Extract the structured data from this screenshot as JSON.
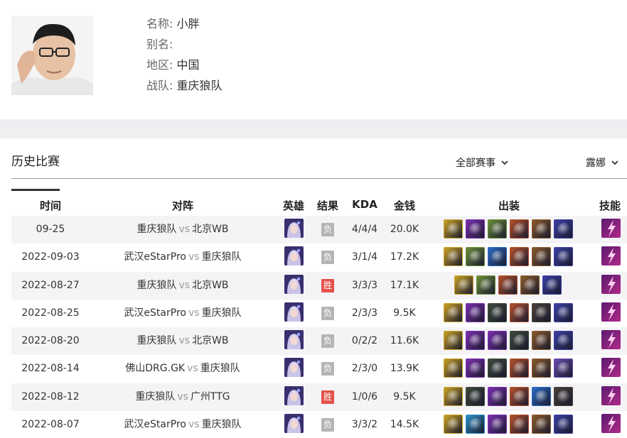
{
  "player": {
    "name_label": "名称:",
    "name": "小胖",
    "alias_label": "别名:",
    "alias": "",
    "region_label": "地区:",
    "region": "中国",
    "team_label": "战队:",
    "team": "重庆狼队"
  },
  "section": {
    "title": "历史比赛",
    "event_filter": "全部赛事",
    "hero_filter": "露娜"
  },
  "table": {
    "headers": {
      "time": "时间",
      "match": "对阵",
      "hero": "英雄",
      "result": "结果",
      "kda": "KDA",
      "gold": "金钱",
      "items": "出装",
      "skill": "技能"
    },
    "vs": "vs",
    "rows": [
      {
        "date": "09-25",
        "home": "重庆狼队",
        "away": "北京WB",
        "result": "负",
        "win": false,
        "kda": "4/4/4",
        "gold": "20.0K",
        "items": [
          "#c9a227",
          "#7a2fb0",
          "#6b8f3a",
          "#b2502c",
          "#8a5a2b",
          "#3b3fa3"
        ]
      },
      {
        "date": "2022-09-03",
        "home": "武汉eStarPro",
        "away": "重庆狼队",
        "result": "负",
        "win": false,
        "kda": "3/1/4",
        "gold": "17.2K",
        "items": [
          "#c9a227",
          "#6b8f3a",
          "#2a6bc4",
          "#b2502c",
          "#8a5a2b",
          "#3b3fa3"
        ]
      },
      {
        "date": "2022-08-27",
        "home": "重庆狼队",
        "away": "北京WB",
        "result": "胜",
        "win": true,
        "kda": "3/3/3",
        "gold": "17.1K",
        "items": [
          "#c9a227",
          "#6b8f3a",
          "#b2502c",
          "#8a5a2b",
          "#3b3fa3"
        ]
      },
      {
        "date": "2022-08-25",
        "home": "武汉eStarPro",
        "away": "重庆狼队",
        "result": "负",
        "win": false,
        "kda": "2/3/3",
        "gold": "9.5K",
        "items": [
          "#c9a227",
          "#7a2fb0",
          "#3d4a3a",
          "#b2502c",
          "#4a4038",
          "#3b3fa3"
        ]
      },
      {
        "date": "2022-08-20",
        "home": "重庆狼队",
        "away": "北京WB",
        "result": "负",
        "win": false,
        "kda": "0/2/2",
        "gold": "11.6K",
        "items": [
          "#c9a227",
          "#7a2fb0",
          "#7a2fb0",
          "#3d4a3a",
          "#8a5a2b",
          "#3b3fa3"
        ]
      },
      {
        "date": "2022-08-14",
        "home": "佛山DRG.GK",
        "away": "重庆狼队",
        "result": "负",
        "win": false,
        "kda": "2/3/0",
        "gold": "13.9K",
        "items": [
          "#c9a227",
          "#7a2fb0",
          "#3d4a3a",
          "#b2502c",
          "#8a5a2b",
          "#6a4bb0"
        ]
      },
      {
        "date": "2022-08-12",
        "home": "重庆狼队",
        "away": "广州TTG",
        "result": "胜",
        "win": true,
        "kda": "1/0/6",
        "gold": "9.5K",
        "items": [
          "#c9a227",
          "#3d4a3a",
          "#7a2fb0",
          "#b2502c",
          "#2a6bc4",
          "#4a4038"
        ]
      },
      {
        "date": "2022-08-07",
        "home": "武汉eStarPro",
        "away": "重庆狼队",
        "result": "负",
        "win": false,
        "kda": "3/3/2",
        "gold": "14.5K",
        "items": [
          "#c9a227",
          "#2a8fc4",
          "#7a2fb0",
          "#b2502c",
          "#8a5a2b",
          "#3b3fa3"
        ]
      }
    ]
  },
  "colors": {
    "win": "#e4514b",
    "loss": "#b5b5b8",
    "row_alt": "#f4f4f6",
    "band": "#efeff2"
  },
  "icons": {
    "filter_arrow": "chevron-down-icon",
    "hero": "luna-hero-icon",
    "skill": "flash-skill-icon"
  }
}
